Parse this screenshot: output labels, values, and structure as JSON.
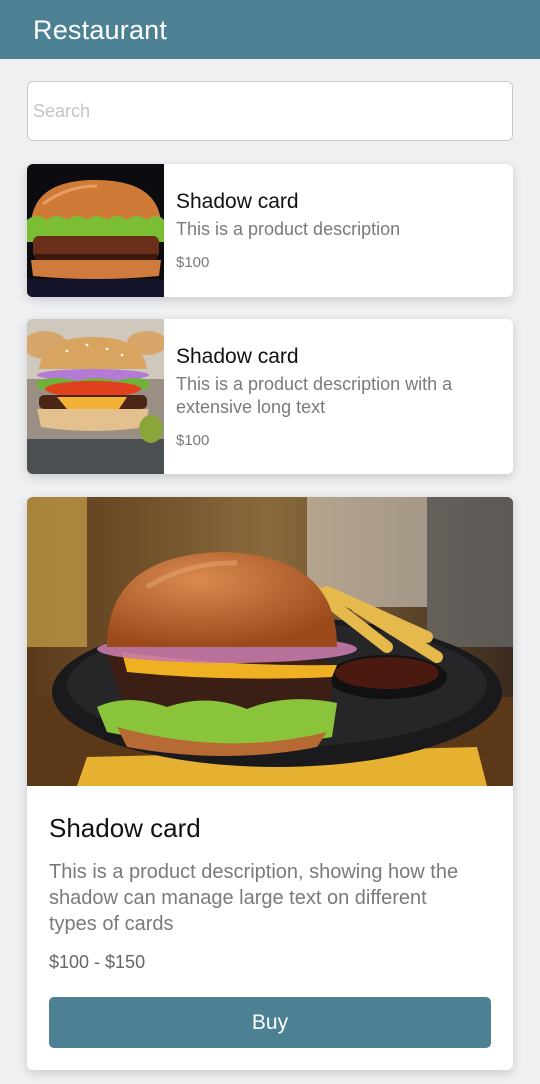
{
  "appbar": {
    "title": "Restaurant"
  },
  "search": {
    "placeholder": "Search",
    "value": ""
  },
  "cards": [
    {
      "title": "Shadow card",
      "description": "This is a product description",
      "price": "$100"
    },
    {
      "title": "Shadow card",
      "description": "This is a product description with a extensive long text",
      "price": "$100"
    },
    {
      "title": "Shadow card",
      "description": "This is a product description, showing how the shadow can manage large text on different types of cards",
      "price": "$100 - $150",
      "button_label": "Buy"
    }
  ],
  "colors": {
    "primary": "#4b8193",
    "background": "#eff0f2",
    "muted_text": "#7a7a7a"
  },
  "icons": {
    "product_images": [
      "burger-photo",
      "burger-photo",
      "burger-plate-photo"
    ]
  }
}
